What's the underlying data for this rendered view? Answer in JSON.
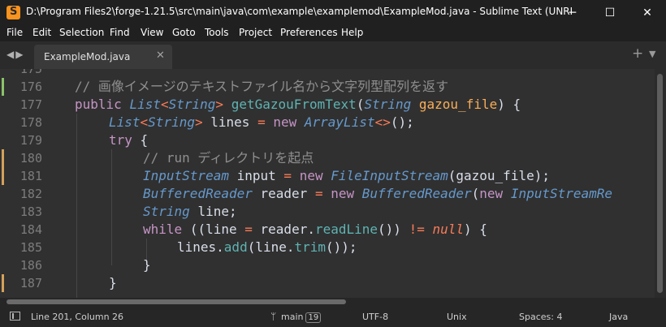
{
  "window": {
    "title": "D:\\Program Files2\\forge-1.21.5\\src\\main\\java\\com\\example\\examplemod\\ExampleMod.java - Sublime Text (UNREGISTERED)",
    "controls": {
      "minimize": "─",
      "maximize": "☐",
      "close": "✕"
    }
  },
  "menu": [
    "File",
    "Edit",
    "Selection",
    "Find",
    "View",
    "Goto",
    "Tools",
    "Project",
    "Preferences",
    "Help"
  ],
  "tabs": {
    "nav_arrows": "◀▶",
    "active": {
      "label": "ExampleMod.java",
      "close": "✕"
    },
    "new_tab": "+",
    "menu": "▼"
  },
  "editor": {
    "partial_top_line": "175",
    "lines": [
      {
        "number": "176",
        "mark": "added"
      },
      {
        "number": "177",
        "mark": "none"
      },
      {
        "number": "178",
        "mark": "none"
      },
      {
        "number": "179",
        "mark": "none"
      },
      {
        "number": "180",
        "mark": "modified"
      },
      {
        "number": "181",
        "mark": "modified"
      },
      {
        "number": "182",
        "mark": "none"
      },
      {
        "number": "183",
        "mark": "none"
      },
      {
        "number": "184",
        "mark": "none"
      },
      {
        "number": "185",
        "mark": "none"
      },
      {
        "number": "186",
        "mark": "none"
      },
      {
        "number": "187",
        "mark": "modified"
      }
    ],
    "code": {
      "l176": {
        "comment": "// 画像イメージのテキストファイル名から文字列型配列を返す"
      },
      "l177": {
        "public": "public",
        "type1": "List",
        "lt": "<",
        "type2": "String",
        "gt": ">",
        "method": "getGazouFromText",
        "open": "(",
        "ptype": "String",
        "param": "gazou_file",
        "close": ") {"
      },
      "l178": {
        "type1": "List",
        "lt": "<",
        "type2": "String",
        "gt": ">",
        "var": "lines",
        "eq": "=",
        "new": "new",
        "ctor": "ArrayList",
        "diamond": "<>",
        "tail": "();"
      },
      "l179": {
        "try": "try",
        "brace": "{"
      },
      "l180": {
        "comment": "// run ディレクトリを起点"
      },
      "l181": {
        "type": "InputStream",
        "var": "input",
        "eq": "=",
        "new": "new",
        "ctor": "FileInputStream",
        "tail": "(gazou_file);"
      },
      "l182": {
        "type": "BufferedReader",
        "var": "reader",
        "eq": "=",
        "new": "new",
        "ctor": "BufferedReader",
        "open": "(",
        "new2": "new",
        "ctor2": "InputStreamRe"
      },
      "l183": {
        "type": "String",
        "tail": "line;"
      },
      "l184": {
        "while": "while",
        "head": "((line",
        "eq": "=",
        "obj": "reader.",
        "call": "readLine",
        "mid": "())",
        "neq": "!=",
        "null": "null",
        "tail": ") {"
      },
      "l185": {
        "obj": "lines.",
        "call1": "add",
        "mid": "(line.",
        "call2": "trim",
        "tail": "());"
      },
      "l186": {
        "brace": "}"
      },
      "l187": {
        "brace": "}"
      }
    }
  },
  "status": {
    "position": "Line 201, Column 26",
    "branch_icon": "ᛘ",
    "branch": "main",
    "branch_count": "19",
    "encoding": "UTF-8",
    "line_endings": "Unix",
    "indentation": "Spaces: 4",
    "syntax": "Java"
  }
}
